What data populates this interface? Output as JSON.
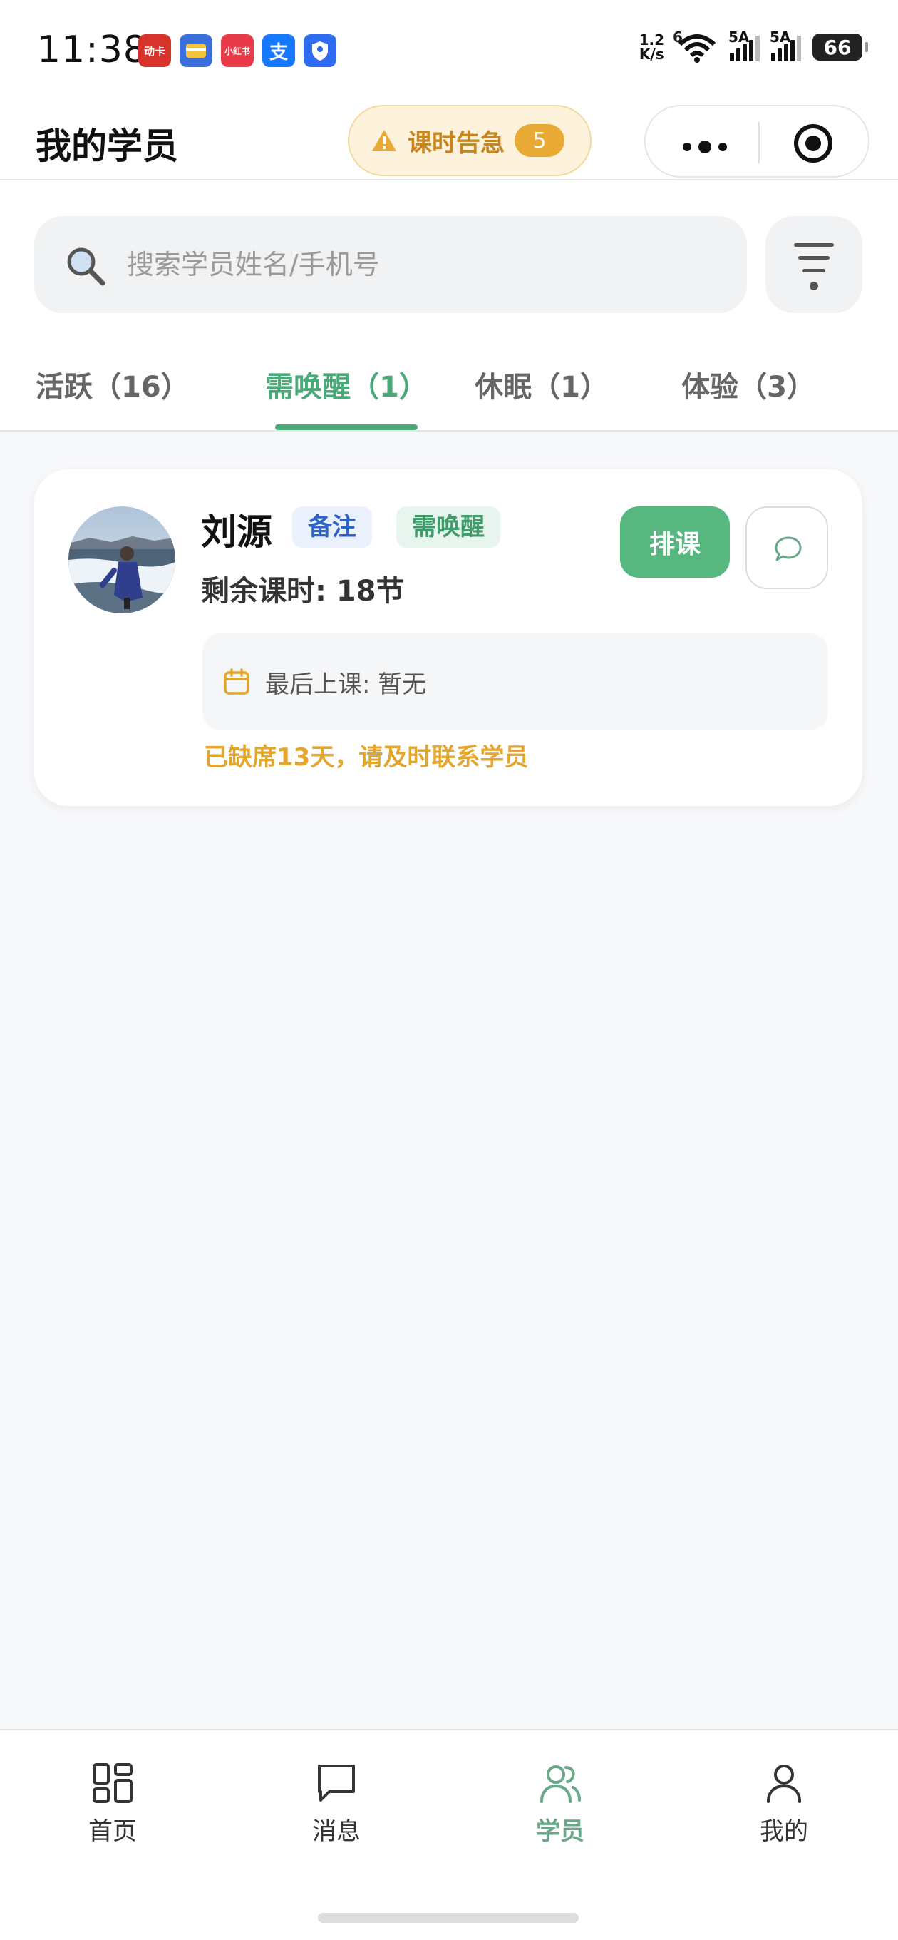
{
  "status_bar": {
    "time": "11:38",
    "app_icons": [
      {
        "name": "damai-app-icon",
        "text": "动卡",
        "color": "#d8332b"
      },
      {
        "name": "wallet-app-icon",
        "text": "",
        "color": "#3b6fdc"
      },
      {
        "name": "xiaohongshu-app-icon",
        "text": "小红书",
        "color": "#e83a49"
      },
      {
        "name": "alipay-app-icon",
        "text": "支",
        "color": "#1677ff"
      },
      {
        "name": "shield-app-icon",
        "text": "",
        "color": "#2f6bf0"
      }
    ],
    "net_speed_value": "1.2",
    "net_speed_unit": "K/s",
    "wifi_label": "6",
    "signal1_label": "5A",
    "signal2_label": "5A",
    "battery": "66"
  },
  "header": {
    "title": "我的学员",
    "alert_label": "课时告急",
    "alert_count": "5"
  },
  "search": {
    "placeholder": "搜索学员姓名/手机号"
  },
  "tabs": [
    {
      "label": "活跃（16）",
      "active": false
    },
    {
      "label": "需唤醒（1）",
      "active": true
    },
    {
      "label": "休眠（1）",
      "active": false
    },
    {
      "label": "体验（3）",
      "active": false
    }
  ],
  "students": [
    {
      "name": "刘源",
      "note_tag": "备注",
      "status_tag": "需唤醒",
      "remaining": "剩余课时: 18节",
      "schedule_label": "排课",
      "last_class": "最后上课: 暂无",
      "warning": "已缺席13天，请及时联系学员"
    }
  ],
  "bottom_nav": [
    {
      "label": "首页",
      "icon": "grid-icon",
      "active": false
    },
    {
      "label": "消息",
      "icon": "message-icon",
      "active": false
    },
    {
      "label": "学员",
      "icon": "users-icon",
      "active": true
    },
    {
      "label": "我的",
      "icon": "user-icon",
      "active": false
    }
  ],
  "colors": {
    "accent_green": "#4aa979",
    "warning_orange": "#e4a52c",
    "alert_bg": "#fdf3dc"
  }
}
